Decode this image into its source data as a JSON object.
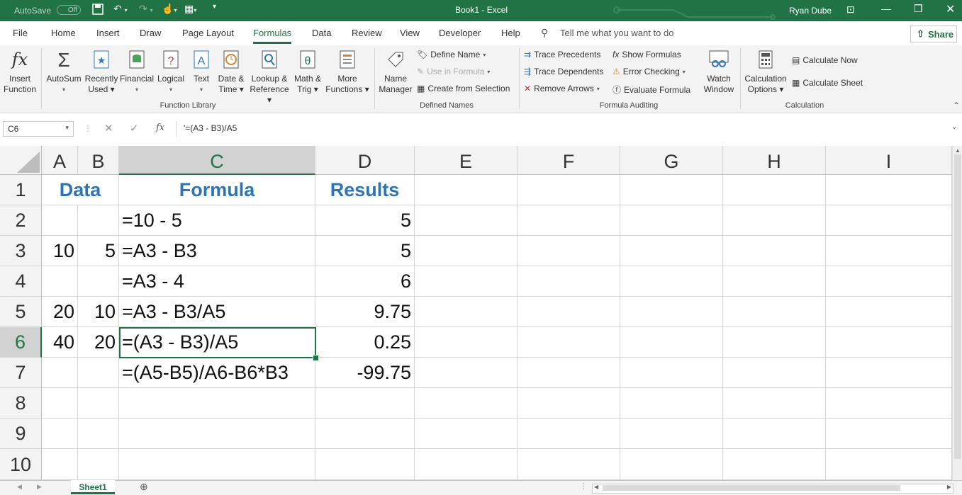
{
  "titlebar": {
    "autosave_label": "AutoSave",
    "autosave_state": "Off",
    "title": "Book1  -  Excel",
    "user": "Ryan Dube"
  },
  "tabs": [
    "File",
    "Home",
    "Insert",
    "Draw",
    "Page Layout",
    "Formulas",
    "Data",
    "Review",
    "View",
    "Developer",
    "Help"
  ],
  "active_tab": "Formulas",
  "tell_me": "Tell me what you want to do",
  "share": "Share",
  "ribbon": {
    "insert_function": [
      "Insert",
      "Function"
    ],
    "function_library": {
      "buttons": [
        {
          "l1": "AutoSum",
          "l2": "▾",
          "icon": "sigma-icon"
        },
        {
          "l1": "Recently",
          "l2": "Used ▾",
          "icon": "star-icon"
        },
        {
          "l1": "Financial",
          "l2": "▾",
          "icon": "database-icon"
        },
        {
          "l1": "Logical",
          "l2": "▾",
          "icon": "question-icon"
        },
        {
          "l1": "Text",
          "l2": "▾",
          "icon": "text-icon"
        },
        {
          "l1": "Date &",
          "l2": "Time ▾",
          "icon": "clock-icon"
        },
        {
          "l1": "Lookup &",
          "l2": "Reference ▾",
          "icon": "magnifier-icon"
        },
        {
          "l1": "Math &",
          "l2": "Trig ▾",
          "icon": "theta-icon"
        },
        {
          "l1": "More",
          "l2": "Functions ▾",
          "icon": "more-functions-icon"
        }
      ],
      "label": "Function Library"
    },
    "defined_names": {
      "name_manager": [
        "Name",
        "Manager"
      ],
      "define_name": "Define Name",
      "use_in_formula": "Use in Formula",
      "create_from_selection": "Create from Selection",
      "label": "Defined Names"
    },
    "formula_auditing": {
      "trace_precedents": "Trace Precedents",
      "trace_dependents": "Trace Dependents",
      "remove_arrows": "Remove Arrows",
      "show_formulas": "Show Formulas",
      "error_checking": "Error Checking",
      "evaluate_formula": "Evaluate Formula",
      "watch_window": [
        "Watch",
        "Window"
      ],
      "label": "Formula Auditing"
    },
    "calculation": {
      "options": [
        "Calculation",
        "Options ▾"
      ],
      "calc_now": "Calculate Now",
      "calc_sheet": "Calculate Sheet",
      "label": "Calculation"
    }
  },
  "formula_bar": {
    "name_box": "C6",
    "content": "'=(A3 - B3)/A5",
    "fx": "fx"
  },
  "grid": {
    "columns": [
      "A",
      "B",
      "C",
      "D",
      "E",
      "F",
      "G",
      "H",
      "I"
    ],
    "rows": [
      "1",
      "2",
      "3",
      "4",
      "5",
      "6",
      "7",
      "8",
      "9",
      "10"
    ],
    "selected_col": "C",
    "selected_row": "6",
    "data_header": "Data",
    "formula_header": "Formula",
    "results_header": "Results",
    "table": [
      {
        "a": "",
        "b": "",
        "c": "=10 - 5",
        "d": "5"
      },
      {
        "a": "10",
        "b": "5",
        "c": "=A3 - B3",
        "d": "5"
      },
      {
        "a": "",
        "b": "",
        "c": "=A3 - 4",
        "d": "6"
      },
      {
        "a": "20",
        "b": "10",
        "c": "=A3 - B3/A5",
        "d": "9.75"
      },
      {
        "a": "40",
        "b": "20",
        "c": "=(A3 - B3)/A5",
        "d": "0.25"
      },
      {
        "a": "",
        "b": "",
        "c": "=(A5-B5)/A6-B6*B3",
        "d": "-99.75"
      }
    ]
  },
  "sheet_tab": "Sheet1",
  "colors": {
    "excel_green": "#217346",
    "header_blue": "#2e75b6"
  }
}
